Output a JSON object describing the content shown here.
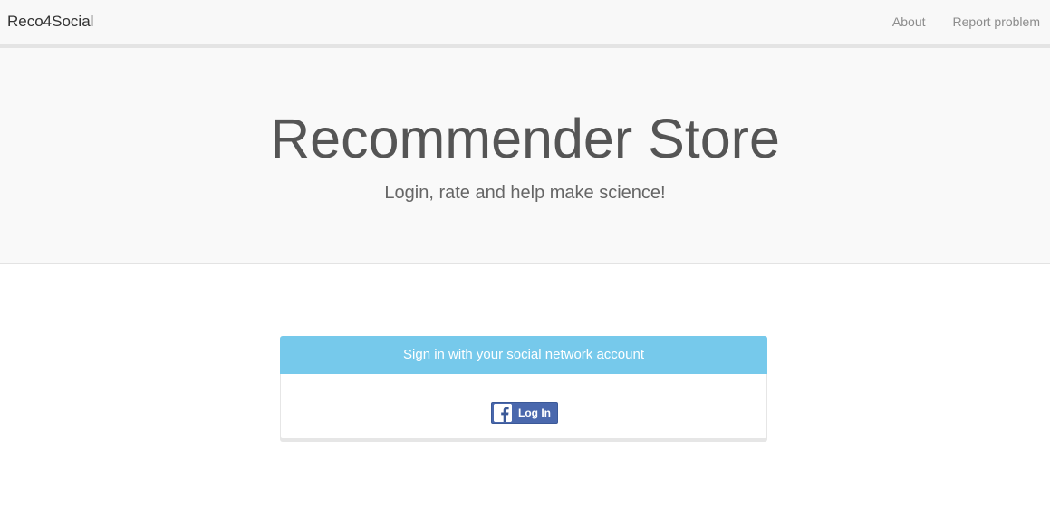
{
  "navbar": {
    "brand": "Reco4Social",
    "links": [
      {
        "label": "About"
      },
      {
        "label": "Report problem"
      }
    ]
  },
  "hero": {
    "title": "Recommender Store",
    "subtitle": "Login, rate and help make science!"
  },
  "login_panel": {
    "heading": "Sign in with your social network account",
    "facebook_button": {
      "label": "Log In",
      "icon": "facebook-icon"
    }
  },
  "colors": {
    "navbar_bg": "#f8f8f8",
    "hero_bg": "#f9f9f9",
    "panel_heading_bg": "#76c9eb",
    "facebook_blue": "#4a68ad"
  }
}
